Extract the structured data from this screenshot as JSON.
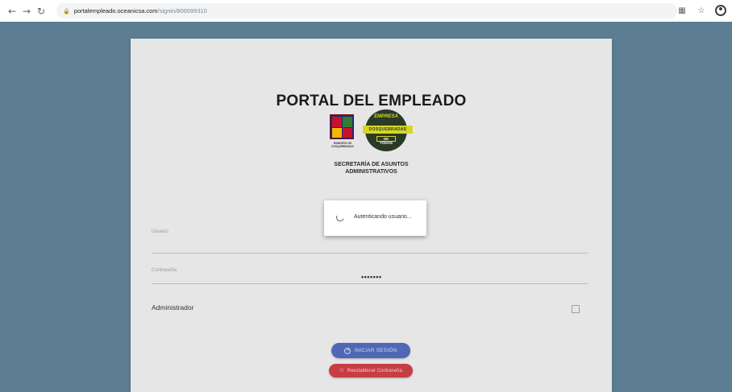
{
  "browser": {
    "url_host": "portalempleado.oceanicsa.com",
    "url_path": "/signin/800099310",
    "icons": {
      "back": "back-arrow-icon",
      "forward": "forward-arrow-icon",
      "reload": "reload-icon",
      "lock": "lock-icon",
      "translate": "translate-icon",
      "bookmark": "star-icon",
      "profile": "profile-icon"
    }
  },
  "card": {
    "title": "PORTAL DEL EMPLEADO",
    "logos": {
      "municipality_caption": "MUNICIPIO DE DOSQUEBRADAS",
      "gear_top_text": "EMPRESA",
      "gear_band_text": "DOSQUEBRADAS",
      "gear_bottom_text": "DE TODOS"
    },
    "department_line1": "SECRETARÍA DE ASUNTOS",
    "department_line2": "ADMINISTRATIVOS",
    "login_title": "Iniciar Sesión",
    "username_label": "Usuario",
    "username_value": "",
    "password_label": "Contraseña",
    "password_value": "•••••••",
    "admin_label": "Administrador",
    "admin_checked": false,
    "login_button": "INICIAR SESIÓN",
    "reset_button": "Reestablecer Contraseña"
  },
  "dialog": {
    "message": "Autenticando usuario..."
  },
  "colors": {
    "background": "#5d7d92",
    "card": "#e6e6e6",
    "login_button": "#4e68b6",
    "reset_button": "#c73d44"
  }
}
